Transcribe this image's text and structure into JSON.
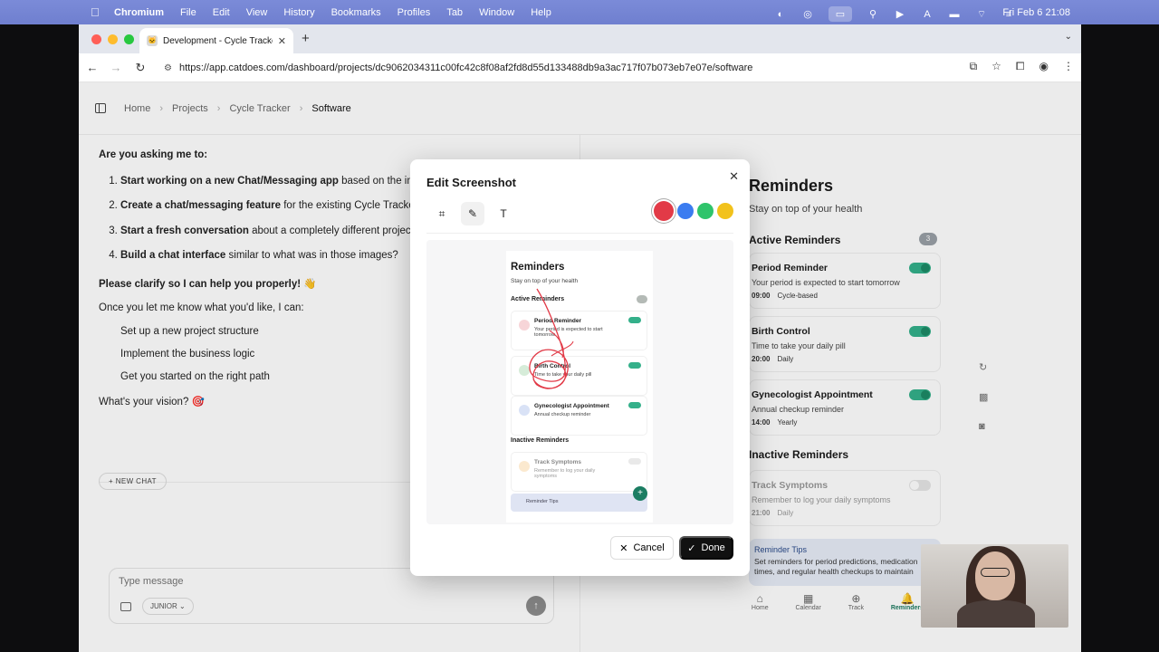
{
  "menubar": {
    "app": "Chromium",
    "menus": [
      "File",
      "Edit",
      "View",
      "History",
      "Bookmarks",
      "Profiles",
      "Tab",
      "Window",
      "Help"
    ],
    "clock": "Fri Feb 6  21:08"
  },
  "browser": {
    "tab_title": "Development - Cycle Tracker",
    "url": "https://app.catdoes.com/dashboard/projects/dc9062034311c00fc42c8f08af2fd8d55d133488db9a3ac717f07b073eb7e07e/software"
  },
  "breadcrumb": [
    "Home",
    "Projects",
    "Cycle Tracker",
    "Software"
  ],
  "chat": {
    "question": "Are you asking me to:",
    "options": [
      {
        "bold": "Start working on a new Chat/Messaging app",
        "rest": " based on the images you shared with me?"
      },
      {
        "bold": "Create a chat/messaging feature",
        "rest": " for the existing Cycle Tracker app?"
      },
      {
        "bold": "Start a fresh conversation",
        "rest": " about a completely different project?"
      },
      {
        "bold": "Build a chat interface",
        "rest": " similar to what was in those images?"
      }
    ],
    "clarify": "Please clarify so I can help you properly! 👋",
    "intro": "Once you let me know what you'd like, I can:",
    "bullets": [
      "Set up a new project structure",
      "Implement the business logic",
      "Get you started on the right path"
    ],
    "closing": "What's your vision? 🎯",
    "new_chat": "+ NEW CHAT",
    "composer_placeholder": "Type message",
    "model": "JUNIOR ⌄"
  },
  "preview": {
    "title": "Reminders",
    "subtitle": "Stay on top of your health",
    "active_label": "Active Reminders",
    "active_count": "3",
    "inactive_label": "Inactive Reminders",
    "reminders": [
      {
        "title": "Period Reminder",
        "desc": "Your period is expected to start tomorrow",
        "time": "09:00",
        "tag": "Cycle-based",
        "on": true
      },
      {
        "title": "Birth Control",
        "desc": "Time to take your daily pill",
        "time": "20:00",
        "tag": "Daily",
        "on": true
      },
      {
        "title": "Gynecologist Appointment",
        "desc": "Annual checkup reminder",
        "time": "14:00",
        "tag": "Yearly",
        "on": true
      }
    ],
    "inactive": [
      {
        "title": "Track Symptoms",
        "desc": "Remember to log your daily symptoms",
        "time": "21:00",
        "tag": "Daily",
        "on": false
      }
    ],
    "tips_title": "Reminder Tips",
    "tips_text": "Set reminders for period predictions, medication times, and regular health checkups to maintain",
    "nav": [
      "Home",
      "Calendar",
      "Track",
      "Reminders"
    ]
  },
  "modal": {
    "title": "Edit Screenshot",
    "colors": [
      "#e23a47",
      "#3b7cf0",
      "#2fc46b",
      "#f2c21b"
    ],
    "selected_color": "#e23a47",
    "cancel": "Cancel",
    "done": "Done",
    "tools": [
      "crop-icon",
      "pencil-icon",
      "text-icon"
    ]
  }
}
